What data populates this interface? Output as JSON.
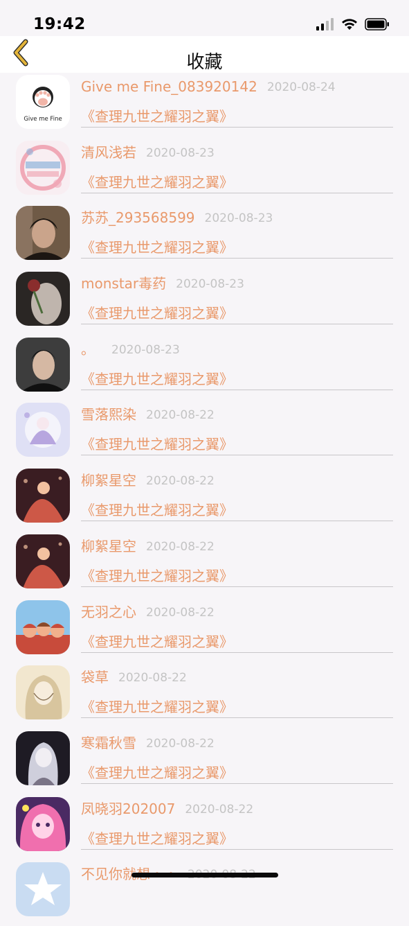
{
  "status_bar": {
    "time": "19:42"
  },
  "nav": {
    "title": "收藏"
  },
  "colors": {
    "accent": "#e9996b",
    "back_arrow": "#e3b43a",
    "date_gray": "#c4c4c4",
    "background": "#f7f5f8"
  },
  "favorites": [
    {
      "name": "Give me Fine_083920142",
      "date": "2020-08-24",
      "book": "《查理九世之耀羽之翼》",
      "avatar_text": "Give me Fine",
      "avatar_colors": [
        "#ffffff",
        "#f1b5a8",
        "#222222"
      ]
    },
    {
      "name": "清风浅若",
      "date": "2020-08-23",
      "book": "《查理九世之耀羽之翼》",
      "avatar_colors": [
        "#f8eef2",
        "#f0a9b7",
        "#8fb4dc"
      ]
    },
    {
      "name": "苏苏_293568599",
      "date": "2020-08-23",
      "book": "《查理九世之耀羽之翼》",
      "avatar_colors": [
        "#6f5a46",
        "#caa48b",
        "#1c1612"
      ]
    },
    {
      "name": "monstar毒药",
      "date": "2020-08-23",
      "book": "《查理九世之耀羽之翼》",
      "avatar_colors": [
        "#2a2624",
        "#d9cfc6",
        "#8a2d2d"
      ]
    },
    {
      "name": "。",
      "date": "2020-08-23",
      "book": "《查理九世之耀羽之翼》",
      "avatar_colors": [
        "#3d3d3d",
        "#d5b8a3",
        "#101010"
      ]
    },
    {
      "name": "雪落熙染",
      "date": "2020-08-22",
      "book": "《查理九世之耀羽之翼》",
      "avatar_colors": [
        "#dfe0f5",
        "#a792d8",
        "#f4f4fb"
      ]
    },
    {
      "name": "柳絮星空",
      "date": "2020-08-22",
      "book": "《查理九世之耀羽之翼》",
      "avatar_colors": [
        "#3a1d22",
        "#e7634e",
        "#f2c1a0"
      ]
    },
    {
      "name": "柳絮星空",
      "date": "2020-08-22",
      "book": "《查理九世之耀羽之翼》",
      "avatar_colors": [
        "#3a1d22",
        "#e7634e",
        "#f2c1a0"
      ]
    },
    {
      "name": "无羽之心",
      "date": "2020-08-22",
      "book": "《查理九世之耀羽之翼》",
      "avatar_colors": [
        "#8ec4ea",
        "#f1b08c",
        "#c84b3b"
      ]
    },
    {
      "name": "袋草",
      "date": "2020-08-22",
      "book": "《查理九世之耀羽之翼》",
      "avatar_colors": [
        "#f2e7cf",
        "#d8c59e",
        "#8a7355"
      ]
    },
    {
      "name": "寒霜秋雪",
      "date": "2020-08-22",
      "book": "《查理九世之耀羽之翼》",
      "avatar_colors": [
        "#1e1b24",
        "#cfcfdc",
        "#7a7486"
      ]
    },
    {
      "name": "凤晓羽202007",
      "date": "2020-08-22",
      "book": "《查理九世之耀羽之翼》",
      "avatar_colors": [
        "#f06fae",
        "#ffd3e8",
        "#4a2a63"
      ]
    },
    {
      "name": "不见你就想・・",
      "date": "2020-08-22",
      "book": "",
      "avatar_colors": [
        "#c9dcf2",
        "#ffffff",
        "#9cc0e8"
      ]
    }
  ]
}
